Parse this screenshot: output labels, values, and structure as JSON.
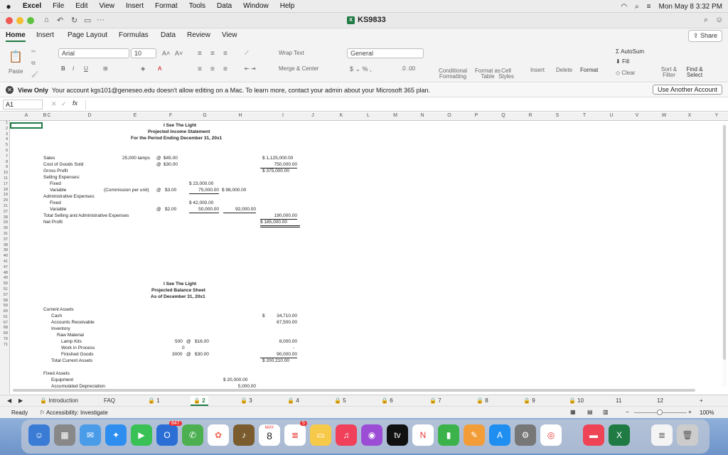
{
  "menubar": {
    "app": "Excel",
    "items": [
      "File",
      "Edit",
      "View",
      "Insert",
      "Format",
      "Tools",
      "Data",
      "Window",
      "Help"
    ],
    "clock": "Mon May 8  3:32 PM"
  },
  "title": {
    "document": "KS9833"
  },
  "ribbon_tabs": [
    "Home",
    "Insert",
    "Page Layout",
    "Formulas",
    "Data",
    "Review",
    "View"
  ],
  "share_label": "Share",
  "ribbon": {
    "paste": "Paste",
    "font": "Arial",
    "size": "10",
    "wrap": "Wrap Text",
    "merge": "Merge & Center",
    "number_format": "General",
    "conditional": "Conditional Formatting",
    "format_table": "Format as Table",
    "cell_styles": "Cell Styles",
    "insert": "Insert",
    "delete": "Delete",
    "format": "Format",
    "autosum": "AutoSum",
    "fill": "Fill",
    "clear": "Clear",
    "sort": "Sort & Filter",
    "find": "Find & Select"
  },
  "notice": {
    "label": "View Only",
    "text": "Your account kgs101@geneseo.edu doesn't allow editing on a Mac. To learn more, contact your admin about your Microsoft 365 plan.",
    "button": "Use Another Account"
  },
  "formula_bar": {
    "cell": "A1",
    "fx": "fx"
  },
  "columns": [
    "A",
    "B",
    "C",
    "D",
    "E",
    "F",
    "G",
    "H",
    "I",
    "J",
    "K",
    "L",
    "M",
    "N",
    "O",
    "P",
    "Q",
    "R",
    "S",
    "T",
    "U",
    "V",
    "W",
    "X",
    "Y"
  ],
  "rows": [
    "1",
    "2",
    "3",
    "4",
    "5",
    "6",
    "7",
    "8",
    "9",
    "10",
    "11",
    "17",
    "18",
    "19",
    "20",
    "21",
    "27",
    "28",
    "29",
    "30",
    "31",
    "37",
    "38",
    "39",
    "40",
    "41",
    "47",
    "48",
    "49",
    "50",
    "51",
    "57",
    "58",
    "59",
    "60",
    "61",
    "67",
    "68",
    "69",
    "70",
    "71"
  ],
  "income": {
    "h1": "I See The Light",
    "h2": "Projected Income Statement",
    "h3": "For the Period Ending December 31, 20x1",
    "sales": "Sales",
    "sales_units": "25,000 lamps",
    "at": "@",
    "sales_price": "$45.00",
    "sales_total": "$  1,125,000.00",
    "cogs": "Cost of Goods Sold",
    "cogs_price": "$30.00",
    "cogs_total": "750,000.00",
    "gp": "Gross Profit",
    "gp_total": "$    375,000.00",
    "sell": "Selling Expenses:",
    "fixed": "Fixed",
    "sell_fixed": "$  23,000.00",
    "variable": "Variable",
    "commission": "(Commission per unit)",
    "comm_rate": "$3.00",
    "sell_var": "75,000.00",
    "sell_total": "$   98,000.00",
    "admin": "Administrative Expenses:",
    "admin_fixed": "$  42,000.00",
    "admin_rate": "$2.00",
    "admin_var": "50,000.00",
    "admin_total": "92,000.00",
    "total_label": "Total Selling and Administrative Expenses",
    "total": "190,000.00",
    "np": "Net Profit",
    "np_total": "$    185,000.00"
  },
  "balance": {
    "h1": "I See The Light",
    "h2": "Projected Balance Sheet",
    "h3": "As of December 31, 20x1",
    "ca": "Current Assets",
    "cash": "Cash",
    "cash_v": "34,710.00",
    "dollar": "$",
    "ar": "Accounts Receivable",
    "ar_v": "67,500.00",
    "inv": "Inventory",
    "raw": "Raw Material",
    "lamp": "Lamp Kits",
    "lamp_q": "500",
    "lamp_p": "$16.00",
    "lamp_v": "8,000.00",
    "wip": "Work in Process",
    "wip_q": "0",
    "wip_v": "-",
    "fg": "Finished Goods",
    "fg_q": "3000",
    "fg_p": "$30.00",
    "fg_v": "90,000.00",
    "tca": "Total Current Assets",
    "tca_v": "$    200,210.00",
    "fa": "Fixed Assets",
    "equip": "Equipment",
    "equip_v": "$  20,000.00",
    "dep": "Accumulated Depreciation",
    "dep_v": "5,000.00"
  },
  "sheet_tabs": [
    "Introduction",
    "FAQ",
    "1",
    "2",
    "3",
    "4",
    "5",
    "6",
    "7",
    "8",
    "9",
    "10",
    "11",
    "12"
  ],
  "status": {
    "ready": "Ready",
    "access": "Accessibility: Investigate",
    "zoom": "100%"
  },
  "dock": {
    "badge_mail": "847",
    "cal_month": "MAY",
    "cal_day": "8",
    "badge_rem": "5"
  }
}
